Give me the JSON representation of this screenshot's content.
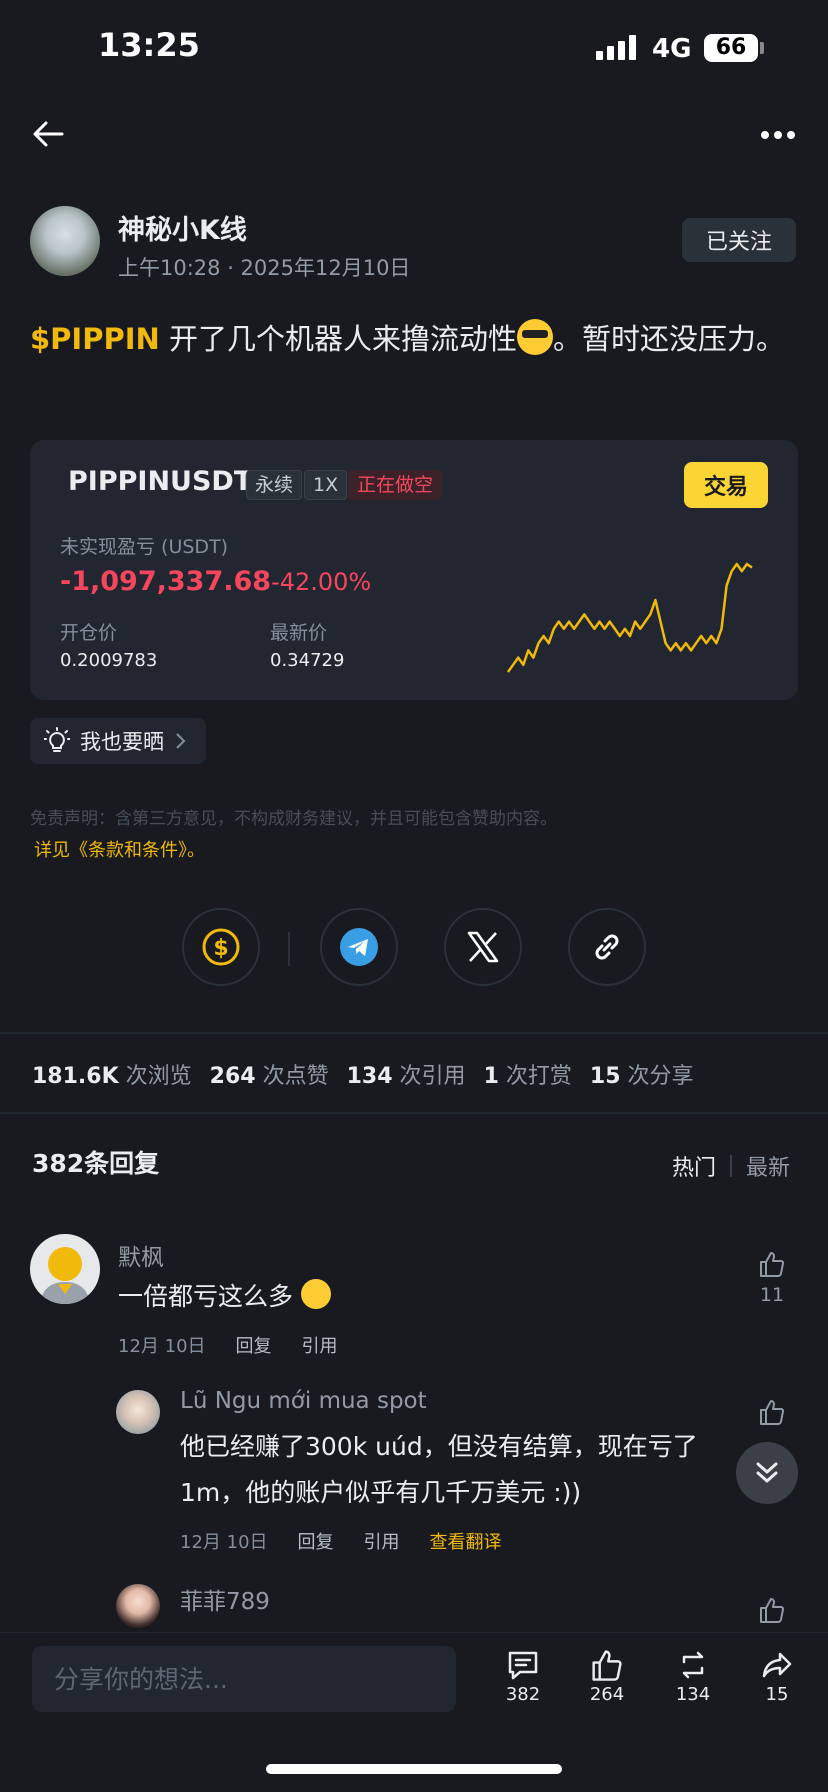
{
  "status_bar": {
    "time": "13:25",
    "network": "4G",
    "battery": "66"
  },
  "post": {
    "author": "神秘小K线",
    "date": "上午10:28 · 2025年12月10日",
    "follow_label": "已关注",
    "cashtag": "$PIPPIN",
    "text_part1": " 开了几个机器人来撸流动性",
    "text_part2": "。暂时还没压力。"
  },
  "trade_card": {
    "symbol": "PIPPINUSDT",
    "chip_perp": "永续",
    "chip_leverage": "1X",
    "chip_side": "正在做空",
    "trade_button": "交易",
    "pnl_label": "未实现盈亏 (USDT)",
    "pnl_value": "-1,097,337.68",
    "pnl_percent": "-42.00%",
    "entry_label": "开仓价",
    "entry_value": "0.2009783",
    "last_label": "最新价",
    "last_value": "0.34729",
    "accent": "#F0B90B",
    "negative": "#F6465D"
  },
  "chart_data": {
    "type": "line",
    "title": "",
    "xlabel": "",
    "ylabel": "",
    "y": [
      0.2,
      0.21,
      0.22,
      0.21,
      0.23,
      0.22,
      0.24,
      0.25,
      0.24,
      0.26,
      0.27,
      0.26,
      0.27,
      0.26,
      0.27,
      0.28,
      0.27,
      0.26,
      0.27,
      0.26,
      0.27,
      0.26,
      0.25,
      0.26,
      0.25,
      0.27,
      0.26,
      0.27,
      0.28,
      0.3,
      0.27,
      0.24,
      0.23,
      0.24,
      0.23,
      0.24,
      0.23,
      0.24,
      0.25,
      0.24,
      0.25,
      0.24,
      0.26,
      0.32,
      0.34,
      0.35,
      0.34,
      0.35,
      0.345
    ],
    "color": "#F0B90B"
  },
  "share_too": "我也要晒",
  "disclaimer": "免责声明：含第三方意见，不构成财务建议，并且可能包含赞助内容。",
  "terms": "详见《条款和条件》。",
  "share_icons": [
    "tip-icon",
    "telegram-icon",
    "x-icon",
    "link-icon"
  ],
  "stats": [
    {
      "value": "181.6K",
      "label": "次浏览"
    },
    {
      "value": "264",
      "label": "次点赞"
    },
    {
      "value": "134",
      "label": "次引用"
    },
    {
      "value": "1",
      "label": "次打赏"
    },
    {
      "value": "15",
      "label": "次分享"
    }
  ],
  "replies": {
    "count_label": "382条回复",
    "sort_hot": "热门",
    "sort_new": "最新"
  },
  "comments": [
    {
      "name": "默枫",
      "text": "一倍都亏这么多",
      "date": "12月 10日",
      "reply": "回复",
      "quote": "引用",
      "likes": "11"
    },
    {
      "name": "Lũ Ngu mới mua spot",
      "text": "他已经赚了300k uúd，但没有结算，现在亏了1m，他的账户似乎有几千万美元 :))",
      "date": "12月 10日",
      "reply": "回复",
      "quote": "引用",
      "translate": "查看翻译"
    },
    {
      "name": "菲菲789"
    }
  ],
  "bottom_bar": {
    "placeholder": "分享你的想法...",
    "comments": "382",
    "likes": "264",
    "reposts": "134",
    "shares": "15"
  }
}
